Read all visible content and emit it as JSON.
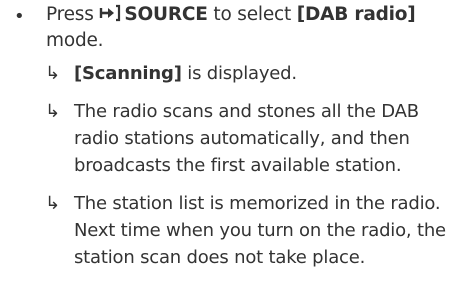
{
  "step": {
    "bullet": "•",
    "press": "Press",
    "source_icon": "source-input-arrow-icon",
    "source_label": "SOURCE",
    "to_select": "to select",
    "mode_label": "[DAB radio]",
    "mode_word": "mode."
  },
  "results": [
    {
      "arrow": "↳",
      "highlight": "[Scanning]",
      "text": "is displayed."
    },
    {
      "arrow": "↳",
      "text": "The radio scans and stones all the DAB radio stations automatically, and then broadcasts the first available station."
    },
    {
      "arrow": "↳",
      "text": "The station list is memorized in the radio. Next time when you turn on the radio, the station scan does not take place."
    }
  ]
}
